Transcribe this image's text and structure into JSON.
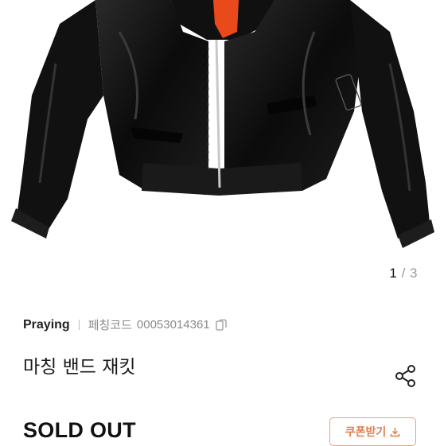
{
  "gallery": {
    "image_alt": "black bomber jacket",
    "current": "1",
    "separator": "/",
    "total": "3"
  },
  "product": {
    "brand": "Praying",
    "code_label": "페칭코드",
    "code_value": "00053014361",
    "title": "마칭 밴드 재킷",
    "status": "SOLD OUT"
  },
  "actions": {
    "coupon_label": "쿠폰받기",
    "copy_icon": "copy-icon",
    "share_icon": "share-icon",
    "download_icon": "download-icon"
  },
  "colors": {
    "accent": "#e07d4f",
    "jacket": "#0e0e0e",
    "lining": "#e84a1c"
  }
}
